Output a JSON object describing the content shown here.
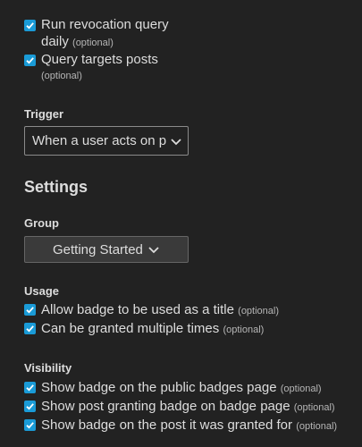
{
  "top_options": [
    {
      "label_line1": "Run revocation query",
      "label_line2": "daily",
      "optional": "(optional)",
      "checked": true
    },
    {
      "label": "Query targets posts",
      "optional": "(optional)",
      "checked": true
    }
  ],
  "trigger": {
    "label": "Trigger",
    "value": "When a user acts on p"
  },
  "settings": {
    "heading": "Settings",
    "group_label": "Group",
    "group_value": "Getting Started"
  },
  "usage": {
    "label": "Usage",
    "items": [
      {
        "label": "Allow badge to be used as a title",
        "optional": "(optional)",
        "checked": true
      },
      {
        "label": "Can be granted multiple times",
        "optional": "(optional)",
        "checked": true
      }
    ]
  },
  "visibility": {
    "label": "Visibility",
    "items": [
      {
        "label": "Show badge on the public badges page",
        "optional": "(optional)",
        "checked": true
      },
      {
        "label": "Show post granting badge on badge page",
        "optional": "(optional)",
        "checked": true
      },
      {
        "label": "Show badge on the post it was granted for",
        "optional": "(optional)",
        "checked": true
      }
    ]
  },
  "colors": {
    "background": "#222222",
    "text": "#dddddd",
    "checkbox": "#1a9bd7",
    "muted": "#b6b6b6"
  }
}
